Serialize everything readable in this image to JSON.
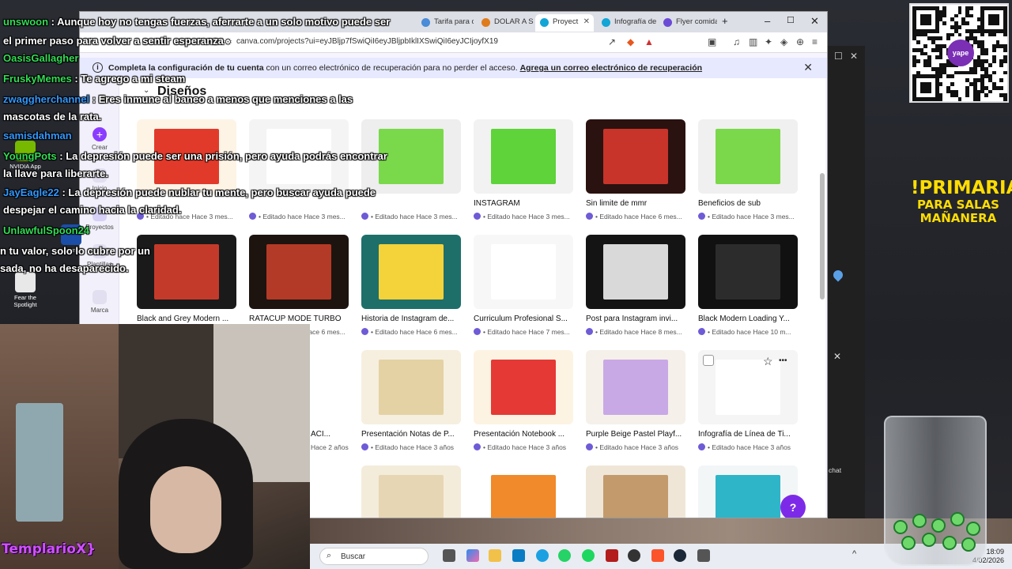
{
  "browser": {
    "tabs": [
      {
        "label": "Tarifa para c",
        "color": "#4b8bd8"
      },
      {
        "label": "DOLAR A SO",
        "color": "#e07b1c"
      },
      {
        "label": "Proyect",
        "color": "#13a5d6"
      },
      {
        "label": "Infografía de",
        "color": "#13a5d6"
      },
      {
        "label": "Flyer comida",
        "color": "#6b4bd6"
      }
    ],
    "new_tab": "+",
    "minimize": "–",
    "maximize": "☐",
    "close": "✕",
    "url": "canva.com/projects?ui=eyJBljp7fSwiQiI6eyJBljpbIklIXSwiQiI6eyJCIjoyfX19"
  },
  "banner": {
    "bold": "Completa la configuración de tu cuenta",
    "text": " con un correo electrónico de recuperación para no perder el acceso. ",
    "link": "Agrega un correo electrónico de recuperación",
    "close": "✕",
    "info": "i"
  },
  "sidebar": {
    "create": "Crear",
    "home": "Inicio",
    "projects": "Proyectos",
    "templates": "Plantillas",
    "brand": "Marca"
  },
  "section": {
    "title": "Diseños",
    "caret": "⌄"
  },
  "designs": [
    {
      "title": "",
      "meta": "Editado hace Hace 3 mes...",
      "bg": "#fdf4e6",
      "art": "#e23a2a"
    },
    {
      "title": "",
      "meta": "Editado hace Hace 3 mes...",
      "bg": "#f4f4f4",
      "art": "#ffffff"
    },
    {
      "title": "",
      "meta": "Editado hace Hace 3 mes...",
      "bg": "#eeeeee",
      "art": "#7ad94a"
    },
    {
      "title": "INSTAGRAM",
      "meta": "Editado hace Hace 3 mes...",
      "bg": "#f2f2f2",
      "art": "#5ed33a"
    },
    {
      "title": "Sin limite de mmr",
      "meta": "Editado hace Hace 6 mes...",
      "bg": "#2a1210",
      "art": "#c8342a"
    },
    {
      "title": "Beneficios de sub",
      "meta": "Editado hace Hace 3 mes...",
      "bg": "#f0f0f0",
      "art": "#7bd84a"
    },
    {
      "title": "Black and Grey Modern ...",
      "meta": "Editado hace Hace 6 mes...",
      "bg": "#1a1a1a",
      "art": "#c43a2a"
    },
    {
      "title": "RATACUP MODE TURBO",
      "meta": "Editado hace Hace 6 mes...",
      "bg": "#1d1410",
      "art": "#b33a26"
    },
    {
      "title": "Historia de Instagram de...",
      "meta": "Editado hace Hace 6 mes...",
      "bg": "#1e6f6a",
      "art": "#f4d23a"
    },
    {
      "title": "Curriculum Profesional S...",
      "meta": "Editado hace Hace 7 mes...",
      "bg": "#f7f7f7",
      "art": "#ffffff"
    },
    {
      "title": "Post para Instagram invi...",
      "meta": "Editado hace Hace 8 mes...",
      "bg": "#141414",
      "art": "#d9d9d9"
    },
    {
      "title": "Black Modern Loading Y...",
      "meta": "Editado hace Hace 10 m...",
      "bg": "#111111",
      "art": "#2c2c2c"
    },
    {
      "title": "Presentación Notas de P...",
      "meta": "Editado hace Hace 3 años",
      "bg": "#f6efdf",
      "art": "#e4d2a4"
    },
    {
      "title": "Presentación Notebook ...",
      "meta": "Editado hace Hace 3 años",
      "bg": "#fdf3e3",
      "art": "#e53935"
    },
    {
      "title": "Purple Beige Pastel Playf...",
      "meta": "Editado hace Hace 3 años",
      "bg": "#f5f0ea",
      "art": "#c9a8e6"
    },
    {
      "title": "Infografía de Línea de Ti...",
      "meta": "Editado hace Hace 3 años",
      "bg": "#f5f5f5",
      "art": "#ffffff"
    },
    {
      "title": "",
      "meta": "",
      "bg": "#f4ecdb",
      "art": "#e6d6b4"
    },
    {
      "title": "",
      "meta": "",
      "bg": "#ffffff",
      "art": "#f08a2a"
    },
    {
      "title": "",
      "meta": "",
      "bg": "#efe6d8",
      "art": "#c39a6b"
    },
    {
      "title": "",
      "meta": "",
      "bg": "#f2f6f7",
      "art": "#2fb5c8"
    }
  ],
  "partial_cards": [
    {
      "meta": "Hace 2 años"
    }
  ],
  "partial_title": "ACI...",
  "help": "?",
  "taskbar": {
    "search_placeholder": "Buscar",
    "time": "18:09",
    "date": "4/02/2026"
  },
  "overlay": {
    "primaria_line1": "!PRIMARIA",
    "primaria_line2": "PARA SALAS",
    "primaria_line3": "MAÑANERA",
    "streamer": "TemplarioX}",
    "qr_logo": "yape",
    "chat_word": "chat"
  },
  "chat": [
    {
      "user": "unswoon",
      "text": "Aunque hoy no tengas fuerzas, aferrarte a un solo motivo puede ser"
    },
    {
      "user": "",
      "text": "el primer paso para volver a sentir esperanza"
    },
    {
      "user": "OasisGallagher",
      "text": ""
    },
    {
      "user": "FruskyMemes",
      "text": "Te agrego a mi steam"
    },
    {
      "user": "zwaggherchannel",
      "text": "Eres inmune al baneo a menos que menciones a las"
    },
    {
      "user": "",
      "text": "mascotas de la rata."
    },
    {
      "user": "samisdahman",
      "text": ""
    },
    {
      "user": "YoungPots",
      "text": "La depresión puede ser una prisión, pero ayuda podrás encontrar"
    },
    {
      "user": "",
      "text": "la llave para liberarte."
    },
    {
      "user": "JayEagle22",
      "text": "La depresión puede nublar tu mente, pero buscar ayuda puede"
    },
    {
      "user": "",
      "text": "despejar el camino hacia la claridad."
    },
    {
      "user": "UnlawfulSpoon24",
      "text": ""
    },
    {
      "user": "",
      "text": "n tu valor, solo lo cubre por un"
    },
    {
      "user": "",
      "text": "sada, no ha desaparecido."
    }
  ],
  "desktop": {
    "icons": [
      "NVIDIA App",
      "Fear the Spotlight",
      "Launc"
    ]
  }
}
